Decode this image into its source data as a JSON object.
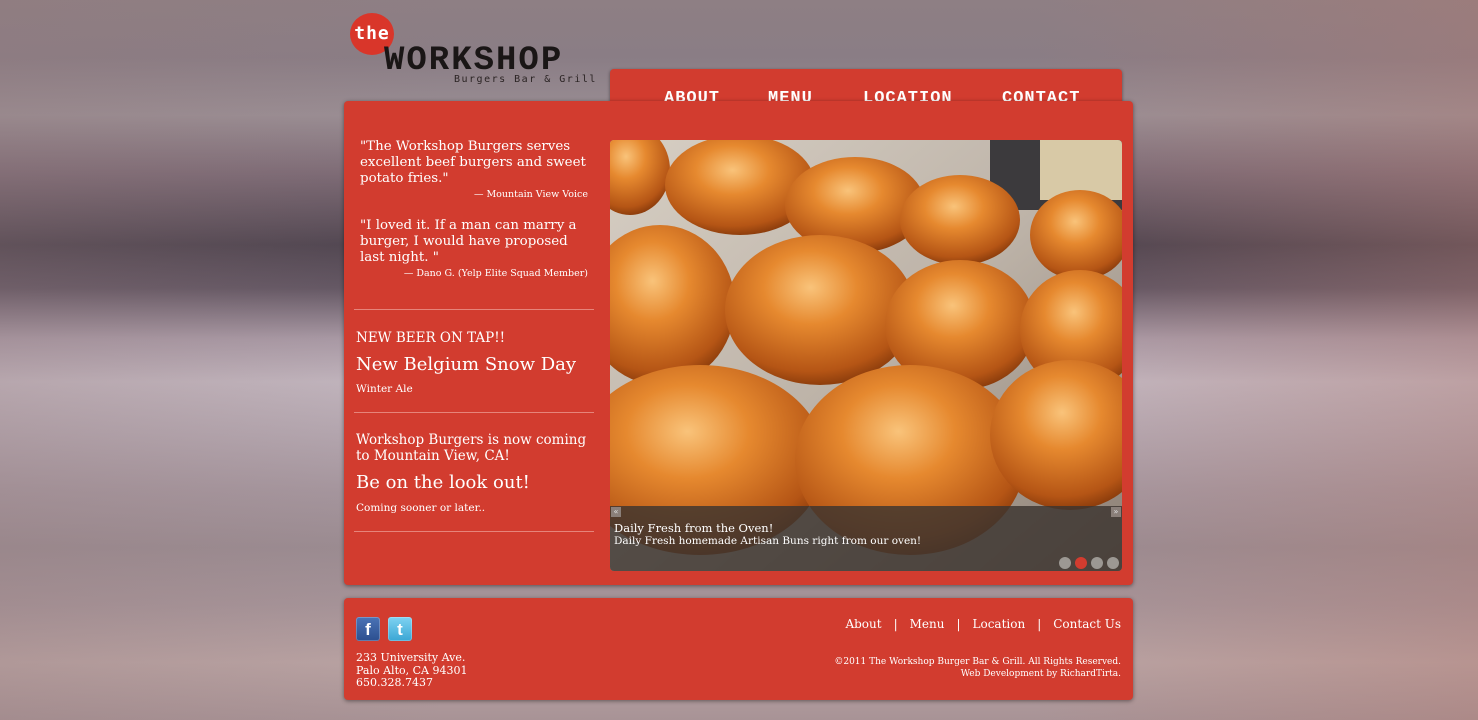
{
  "logo": {
    "the": "the",
    "name": "WORKSHOP",
    "tagline": "Burgers Bar & Grill"
  },
  "nav": {
    "about": "ABOUT",
    "menu": "MENU",
    "location": "LOCATION",
    "contact": "CONTACT"
  },
  "sidebar": {
    "quote1": "\"The Workshop Burgers serves excellent beef burgers and sweet potato fries.\"",
    "quote1_attr": "— Mountain View Voice",
    "quote2": "\"I loved it. If a man can marry a burger, I would have proposed last night. \"",
    "quote2_attr": "— Dano G. (Yelp Elite Squad Member)",
    "news1_head": "NEW BEER ON TAP!!",
    "news1_title": "New Belgium Snow Day",
    "news1_sub": "Winter Ale",
    "news2_head": "Workshop Burgers is now coming to Mountain View, CA!",
    "news2_title": "Be on the look out!",
    "news2_sub": "Coming sooner or later.."
  },
  "slideshow": {
    "caption_title": "Daily Fresh from the Oven!",
    "caption_sub": "Daily Fresh homemade Artisan Buns right from our oven!",
    "prev": "«",
    "next": "»",
    "active_index": 2,
    "count": 4
  },
  "footer": {
    "facebook_icon": "facebook-icon",
    "twitter_icon": "twitter-icon",
    "address1": "233 University Ave.",
    "address2": "Palo Alto, CA 94301",
    "phone": "650.328.7437",
    "links": {
      "about": "About",
      "menu": "Menu",
      "location": "Location",
      "contact": "Contact Us",
      "sep": "|"
    },
    "copyright": "©2011 The Workshop Burger Bar & Grill. All Rights Reserved.",
    "credit": "Web Development by RichardTirta."
  },
  "colors": {
    "accent": "#d23c2f",
    "text": "#ffffff"
  }
}
